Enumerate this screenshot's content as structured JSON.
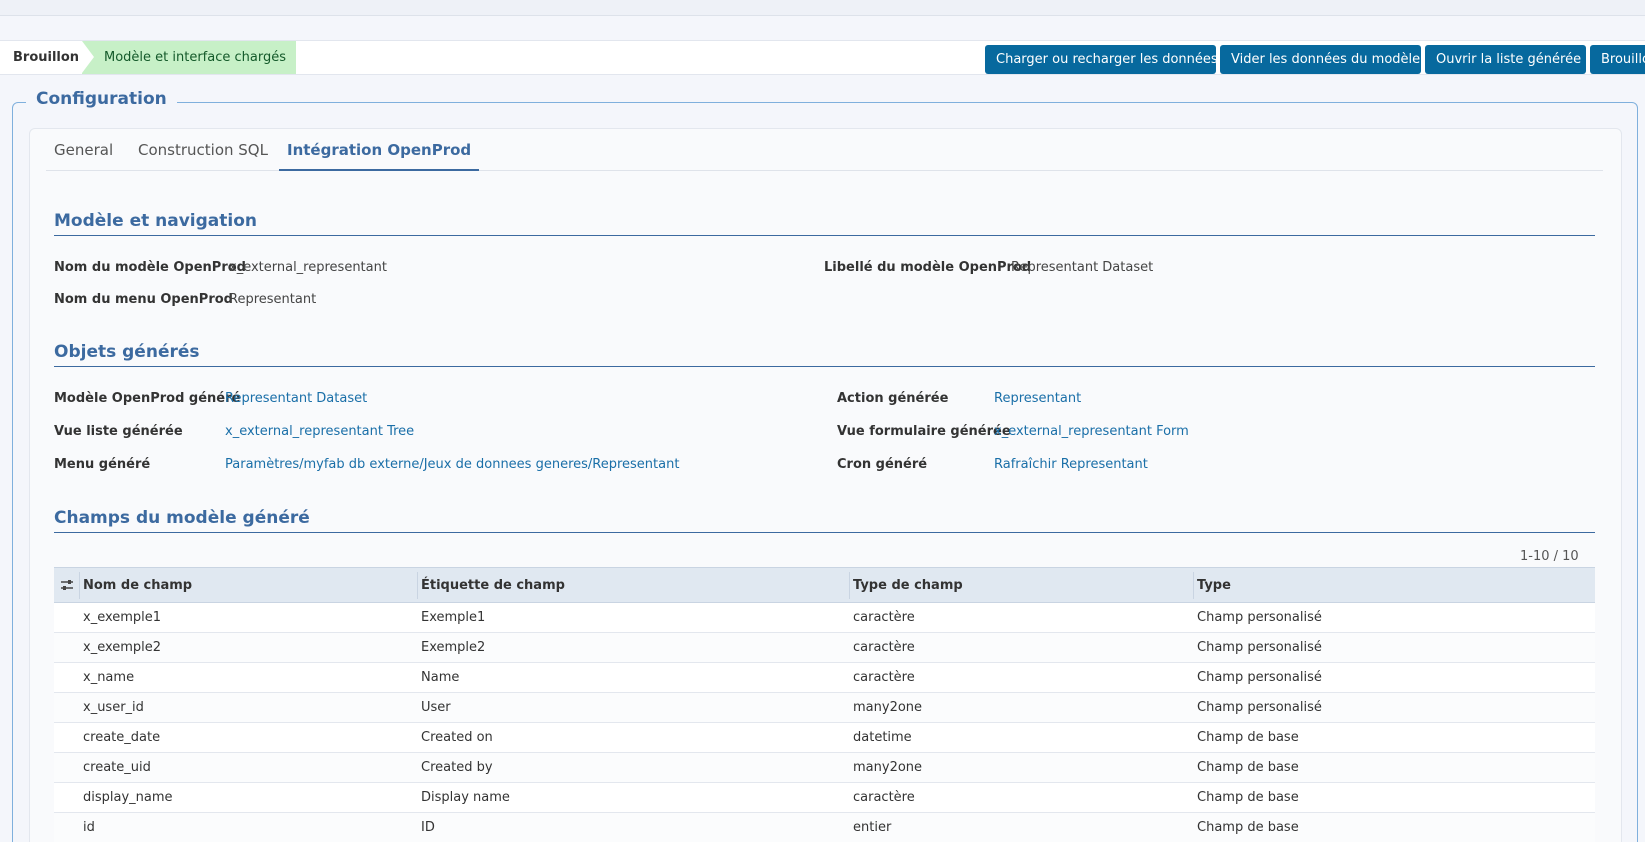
{
  "statusbar": {
    "stages": [
      "Brouillon",
      "Modèle et interface chargés"
    ],
    "buttons": [
      "Charger ou recharger les données",
      "Vider les données du modèle",
      "Ouvrir la liste générée",
      "Brouillon"
    ]
  },
  "configuration": {
    "legend": "Configuration",
    "tabs": [
      "General",
      "Construction SQL",
      "Intégration OpenProd"
    ],
    "active_tab": "Intégration OpenProd"
  },
  "model_nav": {
    "title": "Modèle et navigation",
    "model_name_label": "Nom du modèle OpenProd",
    "model_name_value": "x_external_representant",
    "model_label_label": "Libellé du modèle OpenProd",
    "model_label_value": "Representant Dataset",
    "menu_name_label": "Nom du menu OpenProd",
    "menu_name_value": "Representant"
  },
  "generated": {
    "title": "Objets générés",
    "model_label": "Modèle OpenProd généré",
    "model_value": "Representant Dataset",
    "action_label": "Action générée",
    "action_value": "Representant",
    "tree_label": "Vue liste générée",
    "tree_value": "x_external_representant Tree",
    "form_label": "Vue formulaire générée",
    "form_value": "x_external_representant Form",
    "menu_label": "Menu généré",
    "menu_value": "Paramètres/myfab db externe/Jeux de donnees generes/Representant",
    "cron_label": "Cron généré",
    "cron_value": "Rafraîchir Representant"
  },
  "fields": {
    "title": "Champs du modèle généré",
    "pager": "1-10 / 10",
    "columns": [
      "Nom de champ",
      "Étiquette de champ",
      "Type de champ",
      "Type"
    ],
    "rows": [
      [
        "x_exemple1",
        "Exemple1",
        "caractère",
        "Champ personalisé"
      ],
      [
        "x_exemple2",
        "Exemple2",
        "caractère",
        "Champ personalisé"
      ],
      [
        "x_name",
        "Name",
        "caractère",
        "Champ personalisé"
      ],
      [
        "x_user_id",
        "User",
        "many2one",
        "Champ personalisé"
      ],
      [
        "create_date",
        "Created on",
        "datetime",
        "Champ de base"
      ],
      [
        "create_uid",
        "Created by",
        "many2one",
        "Champ de base"
      ],
      [
        "display_name",
        "Display name",
        "caractère",
        "Champ de base"
      ],
      [
        "id",
        "ID",
        "entier",
        "Champ de base"
      ]
    ]
  },
  "colors": {
    "primary_button": "#07699e",
    "accent": "#3c6aa0",
    "stage_active": "#c7f0c7",
    "link": "#1a6fa8"
  }
}
